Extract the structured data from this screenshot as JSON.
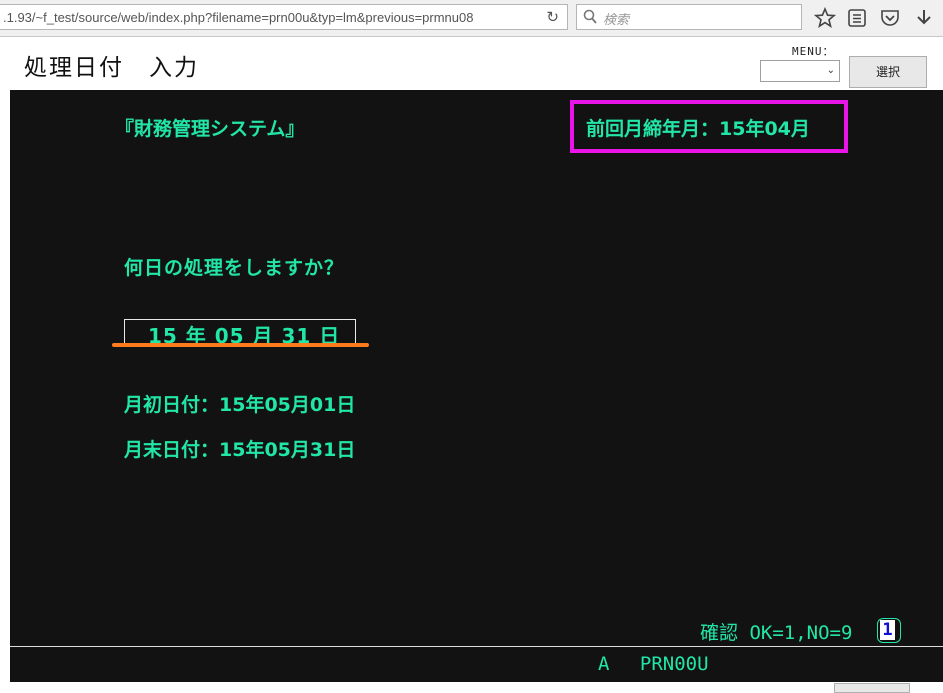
{
  "browser": {
    "url": ".1.93/~f_test/source/web/index.php?filename=prn00u&typ=lm&previous=prmnu08",
    "search_placeholder": "検索"
  },
  "header": {
    "title": "処理日付　入力",
    "menu_label": "MENU：",
    "menu_selected": "",
    "select_button": "選択"
  },
  "terminal": {
    "system_title": "『財務管理システム』",
    "previous_close": "前回月締年月：15年04月",
    "question": "何日の処理をしますか？",
    "date_input": "15 年 05 月 31 日",
    "first_day": "月初日付：15年05月01日",
    "last_day": "月末日付：15年05月31日",
    "confirm_prompt": "確認 OK=1,NO=9",
    "confirm_value": "1",
    "status_line": "A　 PRN00U"
  },
  "colors": {
    "screen_bg": "#121212",
    "text_green": "#22e6a6",
    "highlight_magenta": "#e814e8",
    "underline_orange": "#ff7a1a"
  }
}
